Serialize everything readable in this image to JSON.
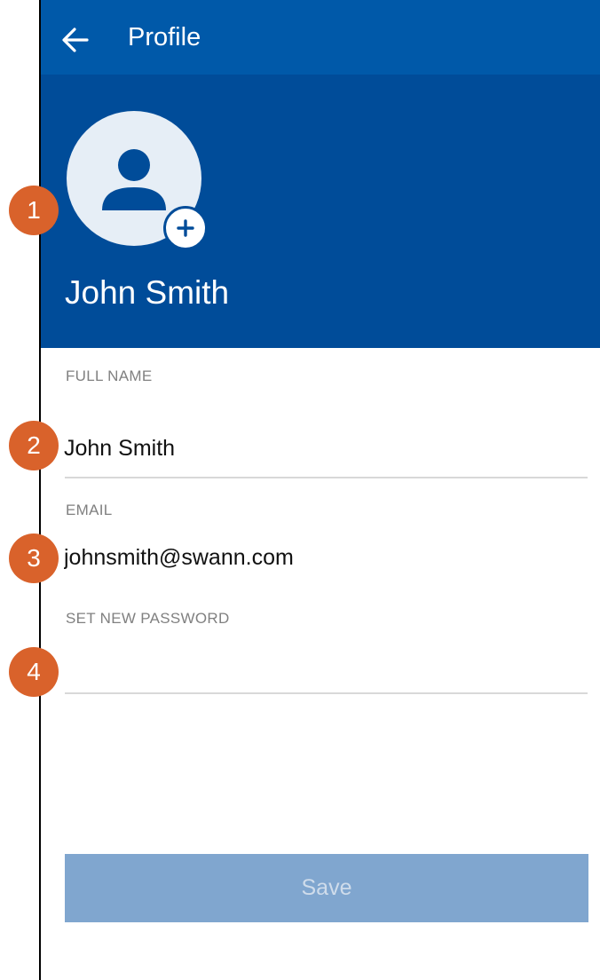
{
  "app_bar": {
    "title": "Profile",
    "back_icon": "arrow-left-icon"
  },
  "header": {
    "avatar_icon": "person-icon",
    "add_photo_icon": "plus-icon",
    "name": "John Smith"
  },
  "form": {
    "full_name": {
      "label": "FULL NAME",
      "value": "John Smith"
    },
    "email": {
      "label": "EMAIL",
      "value": "johnsmith@swann.com"
    },
    "password": {
      "label": "SET NEW PASSWORD",
      "value": ""
    }
  },
  "save_label": "Save",
  "annotations": [
    "1",
    "2",
    "3",
    "4"
  ],
  "colors": {
    "app_bar": "#0059a9",
    "header": "#004c99",
    "badge": "#d9622b",
    "save_disabled": "#80a6cf"
  }
}
